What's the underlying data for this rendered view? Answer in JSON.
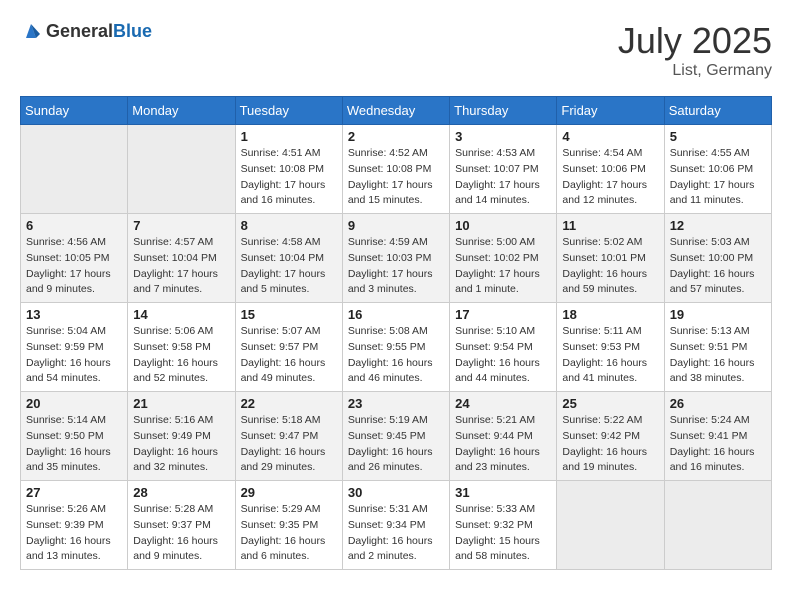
{
  "header": {
    "logo_general": "General",
    "logo_blue": "Blue",
    "month_year": "July 2025",
    "location": "List, Germany"
  },
  "weekdays": [
    "Sunday",
    "Monday",
    "Tuesday",
    "Wednesday",
    "Thursday",
    "Friday",
    "Saturday"
  ],
  "weeks": [
    [
      {
        "day": "",
        "info": ""
      },
      {
        "day": "",
        "info": ""
      },
      {
        "day": "1",
        "info": "Sunrise: 4:51 AM\nSunset: 10:08 PM\nDaylight: 17 hours\nand 16 minutes."
      },
      {
        "day": "2",
        "info": "Sunrise: 4:52 AM\nSunset: 10:08 PM\nDaylight: 17 hours\nand 15 minutes."
      },
      {
        "day": "3",
        "info": "Sunrise: 4:53 AM\nSunset: 10:07 PM\nDaylight: 17 hours\nand 14 minutes."
      },
      {
        "day": "4",
        "info": "Sunrise: 4:54 AM\nSunset: 10:06 PM\nDaylight: 17 hours\nand 12 minutes."
      },
      {
        "day": "5",
        "info": "Sunrise: 4:55 AM\nSunset: 10:06 PM\nDaylight: 17 hours\nand 11 minutes."
      }
    ],
    [
      {
        "day": "6",
        "info": "Sunrise: 4:56 AM\nSunset: 10:05 PM\nDaylight: 17 hours\nand 9 minutes."
      },
      {
        "day": "7",
        "info": "Sunrise: 4:57 AM\nSunset: 10:04 PM\nDaylight: 17 hours\nand 7 minutes."
      },
      {
        "day": "8",
        "info": "Sunrise: 4:58 AM\nSunset: 10:04 PM\nDaylight: 17 hours\nand 5 minutes."
      },
      {
        "day": "9",
        "info": "Sunrise: 4:59 AM\nSunset: 10:03 PM\nDaylight: 17 hours\nand 3 minutes."
      },
      {
        "day": "10",
        "info": "Sunrise: 5:00 AM\nSunset: 10:02 PM\nDaylight: 17 hours\nand 1 minute."
      },
      {
        "day": "11",
        "info": "Sunrise: 5:02 AM\nSunset: 10:01 PM\nDaylight: 16 hours\nand 59 minutes."
      },
      {
        "day": "12",
        "info": "Sunrise: 5:03 AM\nSunset: 10:00 PM\nDaylight: 16 hours\nand 57 minutes."
      }
    ],
    [
      {
        "day": "13",
        "info": "Sunrise: 5:04 AM\nSunset: 9:59 PM\nDaylight: 16 hours\nand 54 minutes."
      },
      {
        "day": "14",
        "info": "Sunrise: 5:06 AM\nSunset: 9:58 PM\nDaylight: 16 hours\nand 52 minutes."
      },
      {
        "day": "15",
        "info": "Sunrise: 5:07 AM\nSunset: 9:57 PM\nDaylight: 16 hours\nand 49 minutes."
      },
      {
        "day": "16",
        "info": "Sunrise: 5:08 AM\nSunset: 9:55 PM\nDaylight: 16 hours\nand 46 minutes."
      },
      {
        "day": "17",
        "info": "Sunrise: 5:10 AM\nSunset: 9:54 PM\nDaylight: 16 hours\nand 44 minutes."
      },
      {
        "day": "18",
        "info": "Sunrise: 5:11 AM\nSunset: 9:53 PM\nDaylight: 16 hours\nand 41 minutes."
      },
      {
        "day": "19",
        "info": "Sunrise: 5:13 AM\nSunset: 9:51 PM\nDaylight: 16 hours\nand 38 minutes."
      }
    ],
    [
      {
        "day": "20",
        "info": "Sunrise: 5:14 AM\nSunset: 9:50 PM\nDaylight: 16 hours\nand 35 minutes."
      },
      {
        "day": "21",
        "info": "Sunrise: 5:16 AM\nSunset: 9:49 PM\nDaylight: 16 hours\nand 32 minutes."
      },
      {
        "day": "22",
        "info": "Sunrise: 5:18 AM\nSunset: 9:47 PM\nDaylight: 16 hours\nand 29 minutes."
      },
      {
        "day": "23",
        "info": "Sunrise: 5:19 AM\nSunset: 9:45 PM\nDaylight: 16 hours\nand 26 minutes."
      },
      {
        "day": "24",
        "info": "Sunrise: 5:21 AM\nSunset: 9:44 PM\nDaylight: 16 hours\nand 23 minutes."
      },
      {
        "day": "25",
        "info": "Sunrise: 5:22 AM\nSunset: 9:42 PM\nDaylight: 16 hours\nand 19 minutes."
      },
      {
        "day": "26",
        "info": "Sunrise: 5:24 AM\nSunset: 9:41 PM\nDaylight: 16 hours\nand 16 minutes."
      }
    ],
    [
      {
        "day": "27",
        "info": "Sunrise: 5:26 AM\nSunset: 9:39 PM\nDaylight: 16 hours\nand 13 minutes."
      },
      {
        "day": "28",
        "info": "Sunrise: 5:28 AM\nSunset: 9:37 PM\nDaylight: 16 hours\nand 9 minutes."
      },
      {
        "day": "29",
        "info": "Sunrise: 5:29 AM\nSunset: 9:35 PM\nDaylight: 16 hours\nand 6 minutes."
      },
      {
        "day": "30",
        "info": "Sunrise: 5:31 AM\nSunset: 9:34 PM\nDaylight: 16 hours\nand 2 minutes."
      },
      {
        "day": "31",
        "info": "Sunrise: 5:33 AM\nSunset: 9:32 PM\nDaylight: 15 hours\nand 58 minutes."
      },
      {
        "day": "",
        "info": ""
      },
      {
        "day": "",
        "info": ""
      }
    ]
  ]
}
